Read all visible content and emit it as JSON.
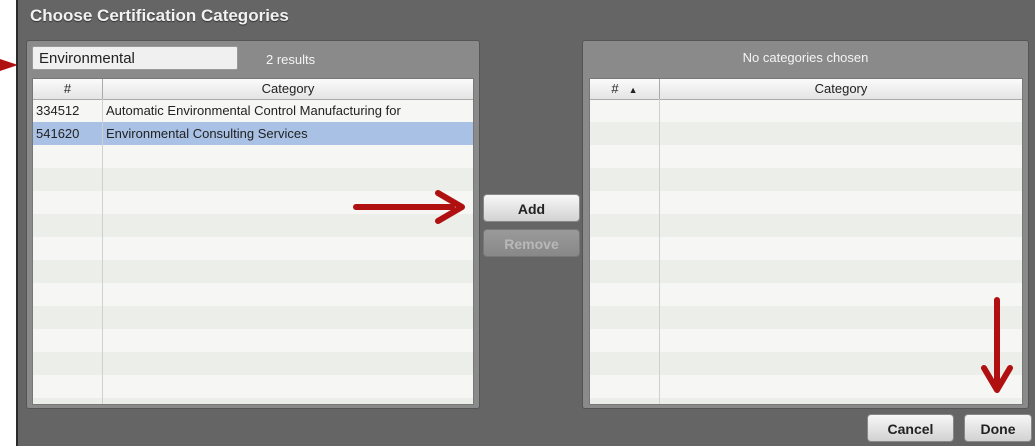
{
  "dialog": {
    "title": "Choose Certification Categories"
  },
  "left": {
    "search_value": "Environmental",
    "results_count": "2 results",
    "header": {
      "num": "#",
      "category": "Category"
    },
    "rows": [
      {
        "num": "334512",
        "category": "Automatic Environmental Control Manufacturing for",
        "selected": false
      },
      {
        "num": "541620",
        "category": "Environmental Consulting Services",
        "selected": true
      }
    ]
  },
  "middle": {
    "add_label": "Add",
    "remove_label": "Remove"
  },
  "right": {
    "status": "No categories chosen",
    "header": {
      "num": "#",
      "sort_glyph": "▲",
      "category": "Category"
    }
  },
  "footer": {
    "cancel_label": "Cancel",
    "done_label": "Done"
  },
  "annotations": {
    "arrow_color": "#b01010"
  },
  "colors": {
    "dialog_bg": "#656565",
    "selection": "#a9c1e4"
  }
}
